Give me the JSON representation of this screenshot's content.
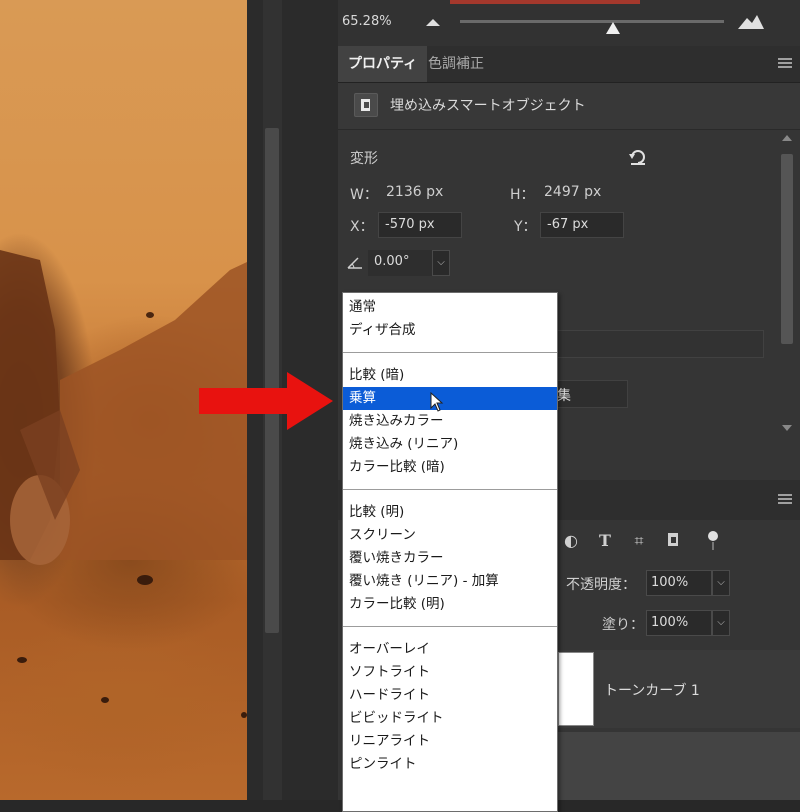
{
  "zoom": {
    "value": "65.28%",
    "slider_level": 0.58
  },
  "tabs": [
    {
      "label": "プロパティ"
    },
    {
      "label": "色調補正"
    }
  ],
  "properties": {
    "object_type": "埋め込みスマートオブジェクト",
    "section_title": "変形",
    "w_label": "W：",
    "w_value": "2136 px",
    "h_label": "H：",
    "h_value": "2497 px",
    "x_label": "X：",
    "x_value": "-570 px",
    "y_label": "Y：",
    "y_value": "-67 px",
    "angle_value": "0.00°",
    "partial_button_text": "集"
  },
  "blend_menu": {
    "groups": [
      [
        "通常",
        "ディザ合成"
      ],
      [
        "比較 (暗)",
        "乗算",
        "焼き込みカラー",
        "焼き込み (リニア)",
        "カラー比較 (暗)"
      ],
      [
        "比較 (明)",
        "スクリーン",
        "覆い焼きカラー",
        "覆い焼き (リニア) - 加算",
        "カラー比較 (明)"
      ],
      [
        "オーバーレイ",
        "ソフトライト",
        "ハードライト",
        "ビビッドライト",
        "リニアライト",
        "ピンライト"
      ]
    ],
    "selected": "乗算"
  },
  "layers": {
    "opacity_label": "不透明度：",
    "opacity_value": "100%",
    "fill_label": "塗り：",
    "fill_value": "100%",
    "layer_name": "トーンカーブ 1"
  },
  "colors": {
    "accent": "#0b5cd7",
    "annotation_arrow": "#e8120f"
  }
}
